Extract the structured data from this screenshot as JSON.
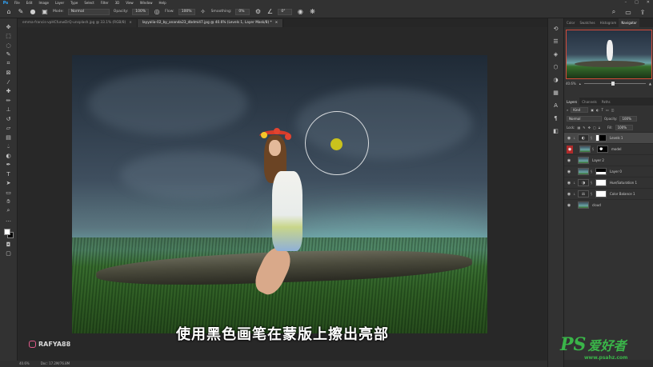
{
  "menu": [
    "File",
    "Edit",
    "Image",
    "Layer",
    "Type",
    "Select",
    "Filter",
    "3D",
    "View",
    "Window",
    "Help"
  ],
  "options": {
    "mode_label": "Mode:",
    "mode_value": "Normal",
    "opacity_label": "Opacity:",
    "opacity_value": "100%",
    "flow_label": "Flow:",
    "flow_value": "100%",
    "smoothing_label": "Smoothing:",
    "smoothing_value": "0%",
    "angle_value": "0°"
  },
  "tabs": [
    {
      "label": "emma-francis-vpHCfunwDrQ-unsplash.jpg @ 33.1% (RGB/8)",
      "active": false
    },
    {
      "label": "layyalia-02_by_ananda23_dbdmi47.jpg @ 40.6% (Levels 1, Layer Mask/8) *",
      "active": true
    }
  ],
  "subtitle": "使用黑色画笔在蒙版上擦出亮部",
  "watermark": "RAFYA88",
  "status": {
    "zoom": "40.6%",
    "doc": "Doc: 17.2M/76.8M"
  },
  "panels": {
    "top_tabs": [
      "Color",
      "Swatches",
      "Histogram",
      "Navigator"
    ],
    "navigator_zoom": "40.6%",
    "layer_tabs": [
      "Layers",
      "Channels",
      "Paths"
    ],
    "kind_label": "Kind",
    "blend_mode": "Normal",
    "opacity_label": "Opacity:",
    "opacity_value": "100%",
    "lock_label": "Lock:",
    "fill_label": "Fill:",
    "fill_value": "100%"
  },
  "layers": [
    {
      "name": "Levels 1",
      "thumb": "adj",
      "mask": "mask-b",
      "active": true,
      "eye_red": false
    },
    {
      "name": "model",
      "thumb": "photo1",
      "mask": "mask-b2",
      "active": false,
      "eye_red": true
    },
    {
      "name": "Layer 2",
      "thumb": "photo1",
      "mask": "",
      "active": false,
      "eye_red": false
    },
    {
      "name": "Layer 0",
      "thumb": "photo1",
      "mask": "mask-b3",
      "active": false,
      "eye_red": false
    },
    {
      "name": "Hue/Saturation 1",
      "thumb": "adj",
      "mask": "mask-w",
      "active": false,
      "eye_red": false
    },
    {
      "name": "Color Balance 1",
      "thumb": "adj",
      "mask": "mask-w",
      "active": false,
      "eye_red": false
    },
    {
      "name": "cloud",
      "thumb": "photo1",
      "mask": "",
      "active": false,
      "eye_red": false
    }
  ],
  "site_badge": {
    "logo": "PS",
    "cn": "爱好者",
    "url": "www.psahz.com"
  },
  "colors": {
    "accent": "#31a8ff",
    "brush_dot": "#c9c21c",
    "nav_frame": "#d24b3a",
    "site_green": "#3ab549"
  }
}
